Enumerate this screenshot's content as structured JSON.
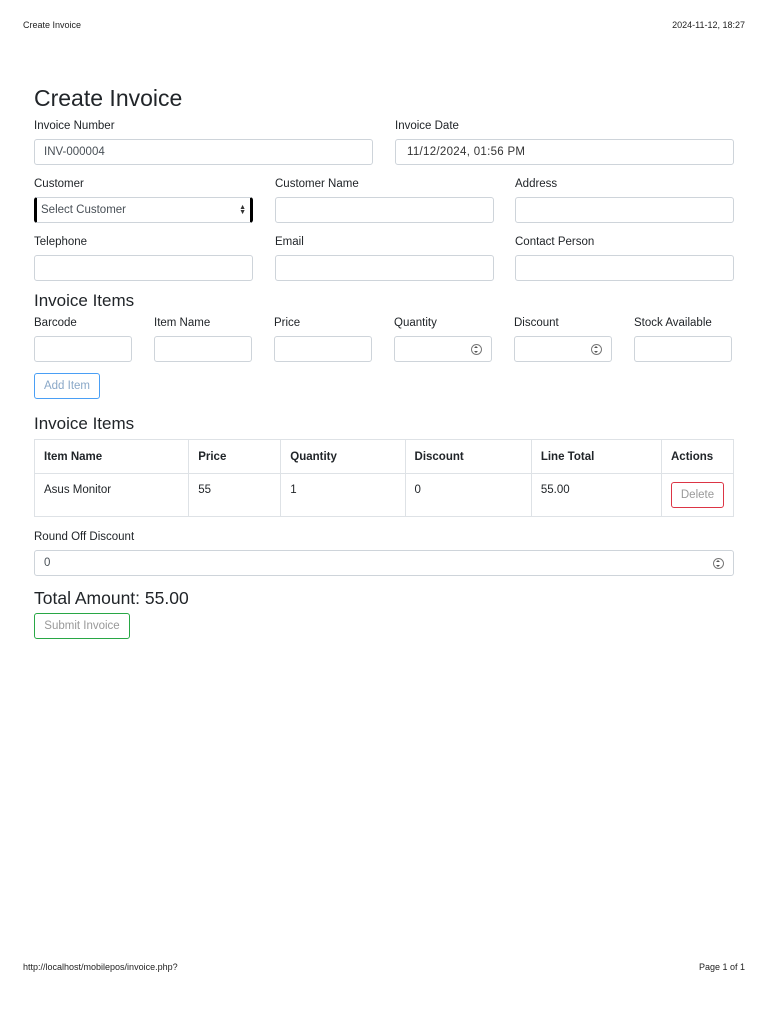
{
  "print_header": {
    "left": "Create Invoice",
    "right": "2024-11-12, 18:27"
  },
  "print_footer": {
    "left": "http://localhost/mobilepos/invoice.php?",
    "right": "Page 1 of 1"
  },
  "page_title": "Create Invoice",
  "invoice": {
    "number_label": "Invoice Number",
    "number_value": "INV-000004",
    "date_label": "Invoice Date",
    "date_value": "11/12/2024, 01:56 PM"
  },
  "customer": {
    "customer_label": "Customer",
    "customer_select_value": "Select Customer",
    "name_label": "Customer Name",
    "address_label": "Address",
    "telephone_label": "Telephone",
    "email_label": "Email",
    "contact_label": "Contact Person"
  },
  "item_entry": {
    "heading": "Invoice Items",
    "barcode_label": "Barcode",
    "item_name_label": "Item Name",
    "price_label": "Price",
    "quantity_label": "Quantity",
    "discount_label": "Discount",
    "stock_label": "Stock Available",
    "add_button": "Add Item"
  },
  "items_table": {
    "heading": "Invoice Items",
    "columns": [
      "Item Name",
      "Price",
      "Quantity",
      "Discount",
      "Line Total",
      "Actions"
    ],
    "rows": [
      {
        "item_name": "Asus Monitor",
        "price": "55",
        "quantity": "1",
        "discount": "0",
        "line_total": "55.00",
        "action": "Delete"
      }
    ]
  },
  "round_off": {
    "label": "Round Off Discount",
    "value": "0"
  },
  "total": {
    "text": "Total Amount: 55.00"
  },
  "submit_button": "Submit Invoice",
  "colors": {
    "primary": "#4a9ff5",
    "danger": "#dc3545",
    "success": "#28a745",
    "border": "#ced4da"
  }
}
